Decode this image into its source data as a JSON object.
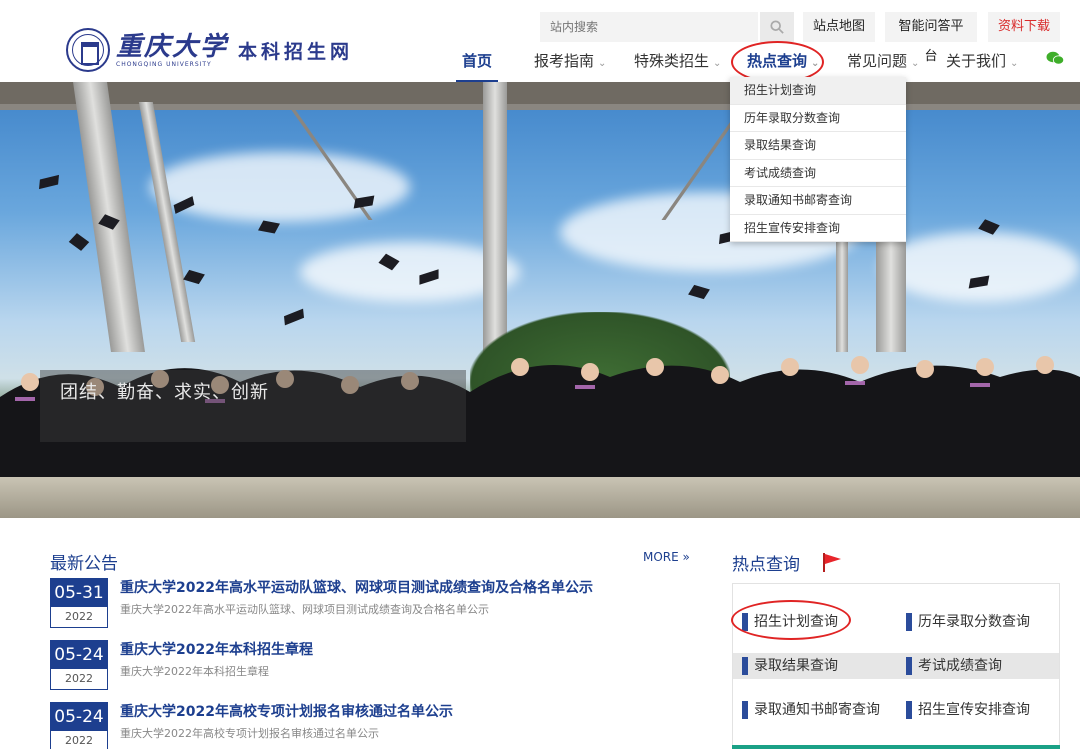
{
  "header": {
    "logo_cn": "重庆大学",
    "logo_en": "CHONGQING UNIVERSITY",
    "site_name": "本科招生网",
    "search_placeholder": "站内搜索",
    "top_buttons": [
      "站点地图",
      "智能问答平台",
      "资料下载"
    ],
    "nav": [
      {
        "label": "首页",
        "has_dropdown": false,
        "active": true
      },
      {
        "label": "报考指南",
        "has_dropdown": true
      },
      {
        "label": "特殊类招生",
        "has_dropdown": true
      },
      {
        "label": "热点查询",
        "has_dropdown": true,
        "highlighted": true
      },
      {
        "label": "常见问题",
        "has_dropdown": true
      },
      {
        "label": "关于我们",
        "has_dropdown": true
      }
    ],
    "wechat_icon": "wechat-icon"
  },
  "dropdown": {
    "items": [
      "招生计划查询",
      "历年录取分数查询",
      "录取结果查询",
      "考试成绩查询",
      "录取通知书邮寄查询",
      "招生宣传安排查询"
    ]
  },
  "hero": {
    "slogan": "团结、勤奋、求实、创新"
  },
  "news": {
    "title": "最新公告",
    "more": "MORE »",
    "items": [
      {
        "md": "05-31",
        "year": "2022",
        "title": "重庆大学2022年高水平运动队篮球、网球项目测试成绩查询及合格名单公示",
        "summary": "重庆大学2022年高水平运动队篮球、网球项目测试成绩查询及合格名单公示"
      },
      {
        "md": "05-24",
        "year": "2022",
        "title": "重庆大学2022年本科招生章程",
        "summary": "重庆大学2022年本科招生章程"
      },
      {
        "md": "05-24",
        "year": "2022",
        "title": "重庆大学2022年高校专项计划报名审核通过名单公示",
        "summary": "重庆大学2022年高校专项计划报名审核通过名单公示"
      }
    ]
  },
  "hot": {
    "title": "热点查询",
    "links": [
      "招生计划查询",
      "历年录取分数查询",
      "录取结果查询",
      "考试成绩查询",
      "录取通知书邮寄查询",
      "招生宣传安排查询"
    ]
  },
  "colors": {
    "brand": "#1d3f8f",
    "accent_red": "#e02424",
    "download_red": "#d92b2b"
  }
}
